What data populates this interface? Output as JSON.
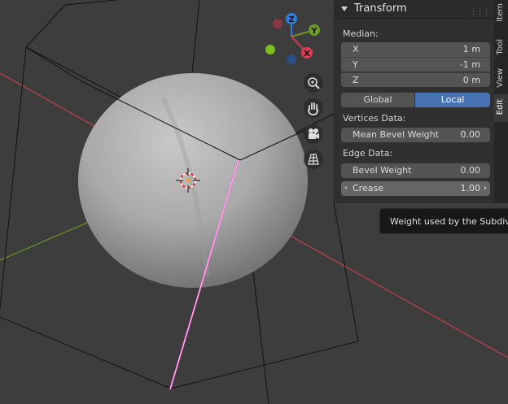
{
  "gizmo": {
    "z_label": "Z",
    "y_label": "Y",
    "x_label": "X"
  },
  "navigation": {
    "zoom": "zoom-icon",
    "pan": "hand-icon",
    "camera": "camera-icon",
    "ortho": "grid-icon"
  },
  "transform_panel": {
    "title": "Transform",
    "median_label": "Median:",
    "x": {
      "label": "X",
      "value": "1 m"
    },
    "y": {
      "label": "Y",
      "value": "-1 m"
    },
    "z": {
      "label": "Z",
      "value": "0 m"
    },
    "global_label": "Global",
    "local_label": "Local",
    "vertices_data_label": "Vertices Data:",
    "mean_bevel_weight": {
      "label": "Mean Bevel Weight",
      "value": "0.00"
    },
    "edge_data_label": "Edge Data:",
    "bevel_weight": {
      "label": "Bevel Weight",
      "value": "0.00"
    },
    "crease": {
      "label": "Crease",
      "value": "1.00"
    }
  },
  "side_tabs": [
    "Item",
    "Tool",
    "View",
    "Edit"
  ],
  "tooltip": {
    "text": "Weight used by the Subdivision Surface modifier"
  },
  "colors": {
    "accent": "#4772b3",
    "axis_x": "#c4404c",
    "axis_y": "#6a9c22",
    "axis_z": "#2e7de0",
    "selected_edge": "#ff66dd"
  }
}
